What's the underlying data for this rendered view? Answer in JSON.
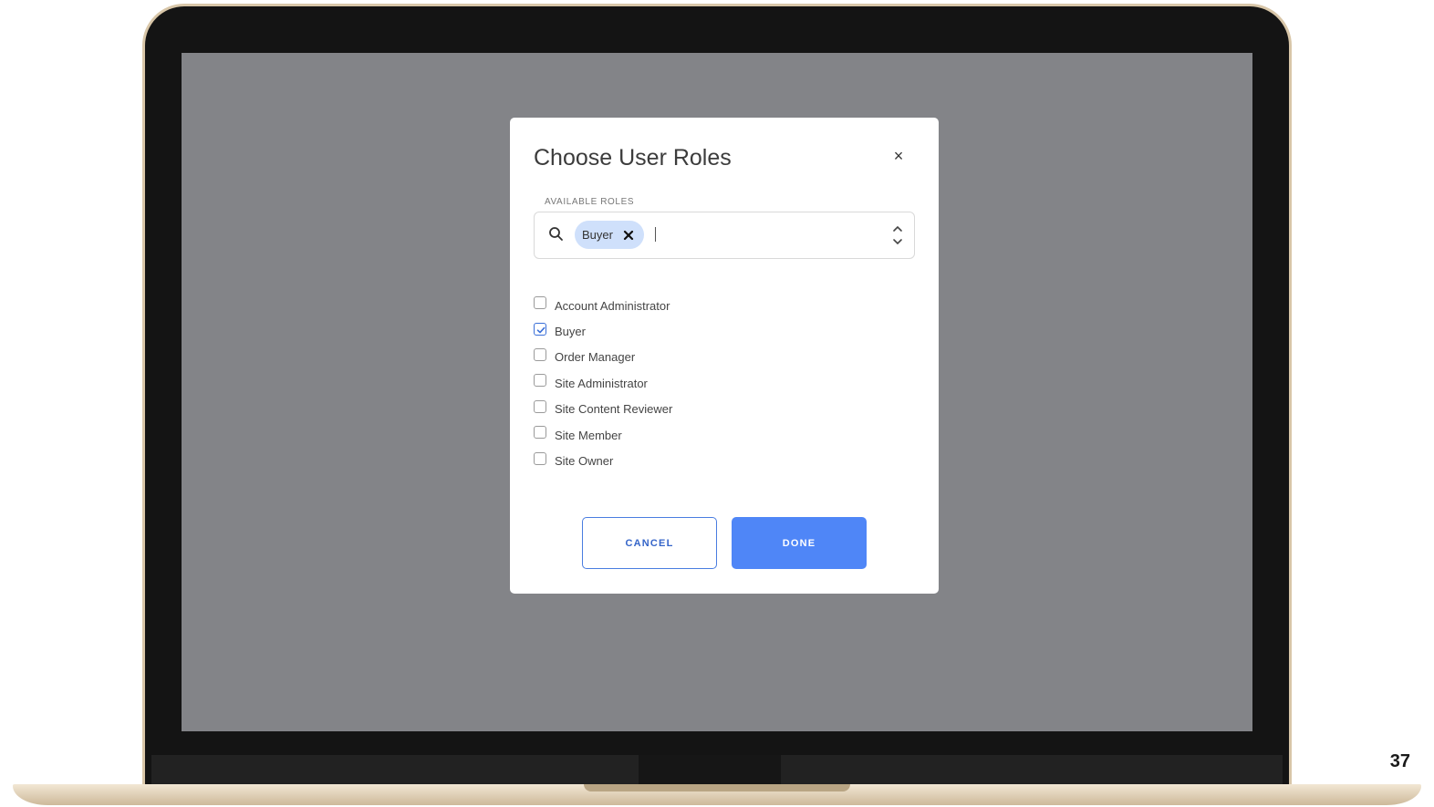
{
  "modal": {
    "title": "Choose User Roles",
    "close_glyph": "×",
    "field_label": "AVAILABLE ROLES",
    "selected_chips": [
      {
        "label": "Buyer"
      }
    ],
    "roles": [
      {
        "label": "Account Administrator",
        "checked": false
      },
      {
        "label": "Buyer",
        "checked": true
      },
      {
        "label": "Order Manager",
        "checked": false
      },
      {
        "label": "Site Administrator",
        "checked": false
      },
      {
        "label": "Site Content Reviewer",
        "checked": false
      },
      {
        "label": "Site Member",
        "checked": false
      },
      {
        "label": "Site Owner",
        "checked": false
      }
    ],
    "cancel_label": "CANCEL",
    "done_label": "DONE"
  },
  "page_number": "37",
  "icons": {
    "search": "search-icon",
    "chip_remove": "close-icon",
    "stepper": "chevron-up-down-icon",
    "checkbox_checked": "check-icon"
  },
  "colors": {
    "accent": "#4f86f7",
    "chip_bg": "#cfe0fb",
    "overlay": "#838488"
  }
}
